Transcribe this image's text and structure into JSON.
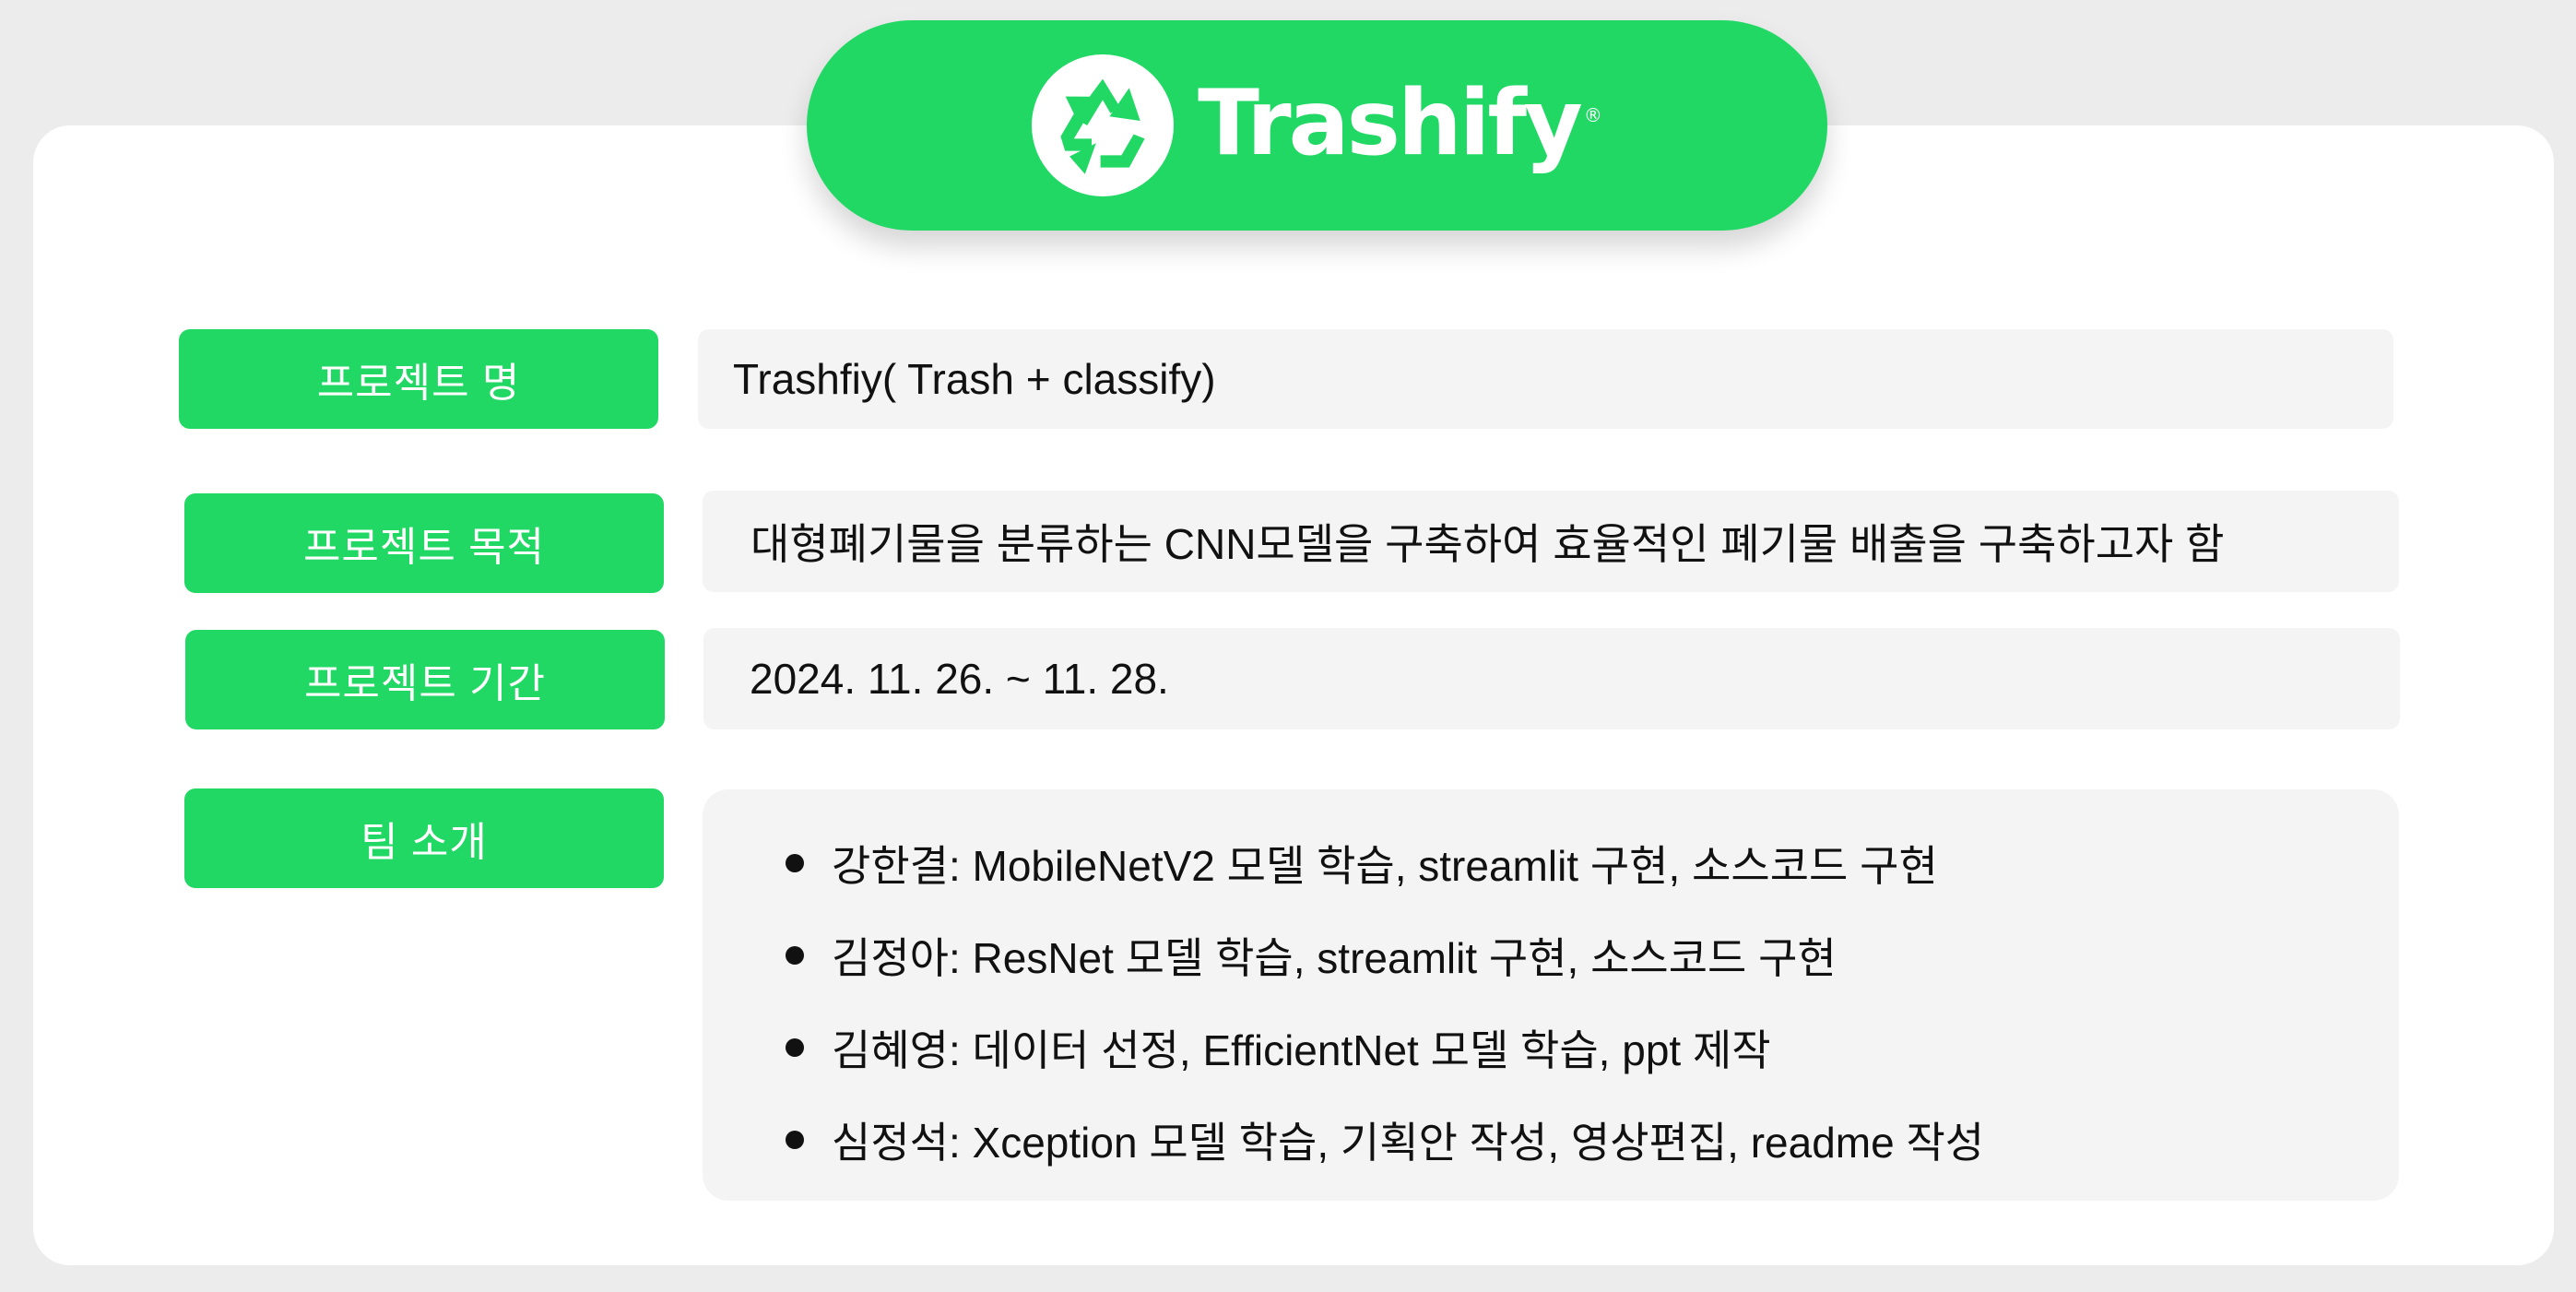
{
  "logo": {
    "icon": "recycle-icon",
    "brand_name": "Trashify",
    "registered_mark": "®"
  },
  "rows": {
    "name": {
      "label": "프로젝트 명",
      "value": "Trashfiy( Trash + classify)"
    },
    "purpose": {
      "label": "프로젝트 목적",
      "value": "대형폐기물을 분류하는 CNN모델을 구축하여 효율적인 폐기물 배출을 구축하고자 함"
    },
    "period": {
      "label": "프로젝트 기간",
      "value": "2024. 11. 26. ~ 11. 28."
    },
    "team": {
      "label": "팀 소개",
      "members": [
        "강한결: MobileNetV2 모델 학습, streamlit 구현, 소스코드 구현",
        "김정아: ResNet 모델 학습, streamlit 구현, 소스코드 구현",
        "김혜영: 데이터 선정, EfficientNet 모델 학습, ppt 제작",
        "심정석: Xception 모델 학습, 기획안 작성, 영상편집, readme 작성"
      ]
    }
  },
  "colors": {
    "accent": "#22d865",
    "page_background": "#ececec",
    "card_background": "#ffffff",
    "value_background": "#f4f4f4"
  }
}
